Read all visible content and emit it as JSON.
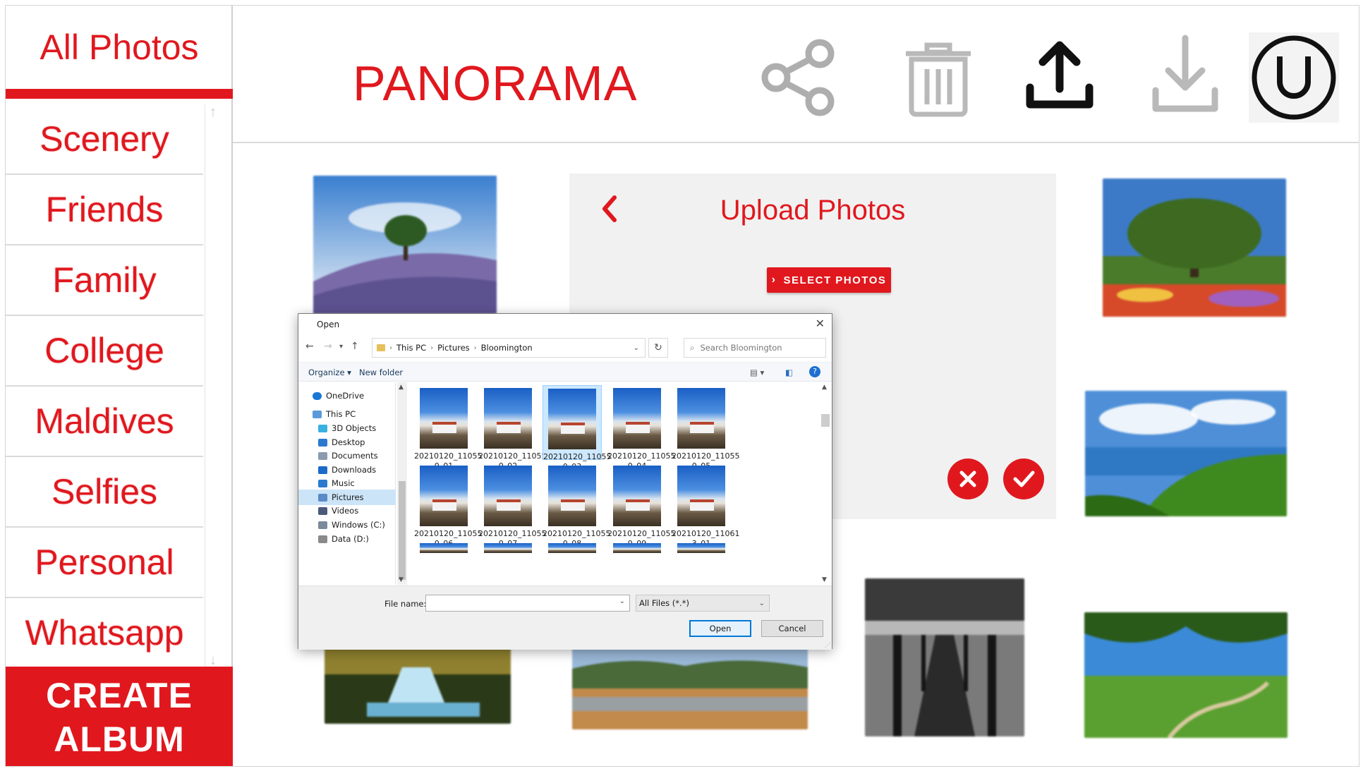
{
  "sidebar": {
    "all_photos": "All Photos",
    "items": [
      {
        "label": "Scenery"
      },
      {
        "label": "Friends"
      },
      {
        "label": "Family"
      },
      {
        "label": "College"
      },
      {
        "label": "Maldives"
      },
      {
        "label": "Selfies"
      },
      {
        "label": "Personal"
      },
      {
        "label": "Whatsapp"
      }
    ],
    "create_album_line1": "CREATE",
    "create_album_line2": "ALBUM"
  },
  "header": {
    "brand": "PANORAMA",
    "icons": [
      "share-icon",
      "trash-icon",
      "upload-icon",
      "download-icon",
      "user-icon"
    ],
    "user_initial": "U"
  },
  "upload_panel": {
    "title": "Upload Photos",
    "select_button": "SELECT PHOTOS",
    "icons": [
      "back-chevron-icon",
      "cancel-icon",
      "confirm-icon"
    ]
  },
  "open_dialog": {
    "title": "Open",
    "breadcrumb": [
      "This PC",
      "Pictures",
      "Bloomington"
    ],
    "search_placeholder": "Search Bloomington",
    "toolbar": {
      "organize": "Organize ▾",
      "new_folder": "New folder"
    },
    "nav": [
      {
        "label": "OneDrive",
        "icon": "cloud-icon"
      },
      {
        "label": "This PC",
        "icon": "pc-icon"
      },
      {
        "label": "3D Objects",
        "icon": "cube-icon"
      },
      {
        "label": "Desktop",
        "icon": "desktop-icon"
      },
      {
        "label": "Documents",
        "icon": "documents-icon"
      },
      {
        "label": "Downloads",
        "icon": "download-arrow-icon"
      },
      {
        "label": "Music",
        "icon": "music-icon"
      },
      {
        "label": "Pictures",
        "icon": "pictures-icon"
      },
      {
        "label": "Videos",
        "icon": "videos-icon"
      },
      {
        "label": "Windows (C:)",
        "icon": "drive-icon"
      },
      {
        "label": "Data (D:)",
        "icon": "drive-icon"
      }
    ],
    "files": [
      {
        "line1": "20210120_11055",
        "line2": "0_01"
      },
      {
        "line1": "20210120_11055",
        "line2": "0_02"
      },
      {
        "line1": "20210120_11055",
        "line2": "0_03"
      },
      {
        "line1": "20210120_11055",
        "line2": "0_04"
      },
      {
        "line1": "20210120_11055",
        "line2": "0_05"
      },
      {
        "line1": "20210120_11055",
        "line2": "0_06"
      },
      {
        "line1": "20210120_11055",
        "line2": "0_07"
      },
      {
        "line1": "20210120_11055",
        "line2": "0_08"
      },
      {
        "line1": "20210120_11055",
        "line2": "0_09"
      },
      {
        "line1": "20210120_11061",
        "line2": "3_01"
      }
    ],
    "selected_file_index": 2,
    "file_name_label": "File name:",
    "file_name_value": "",
    "filter": "All Files (*.*)",
    "open_button": "Open",
    "cancel_button": "Cancel"
  },
  "colors": {
    "brand_red": "#e0181e",
    "selection_blue": "#cce8ff"
  }
}
